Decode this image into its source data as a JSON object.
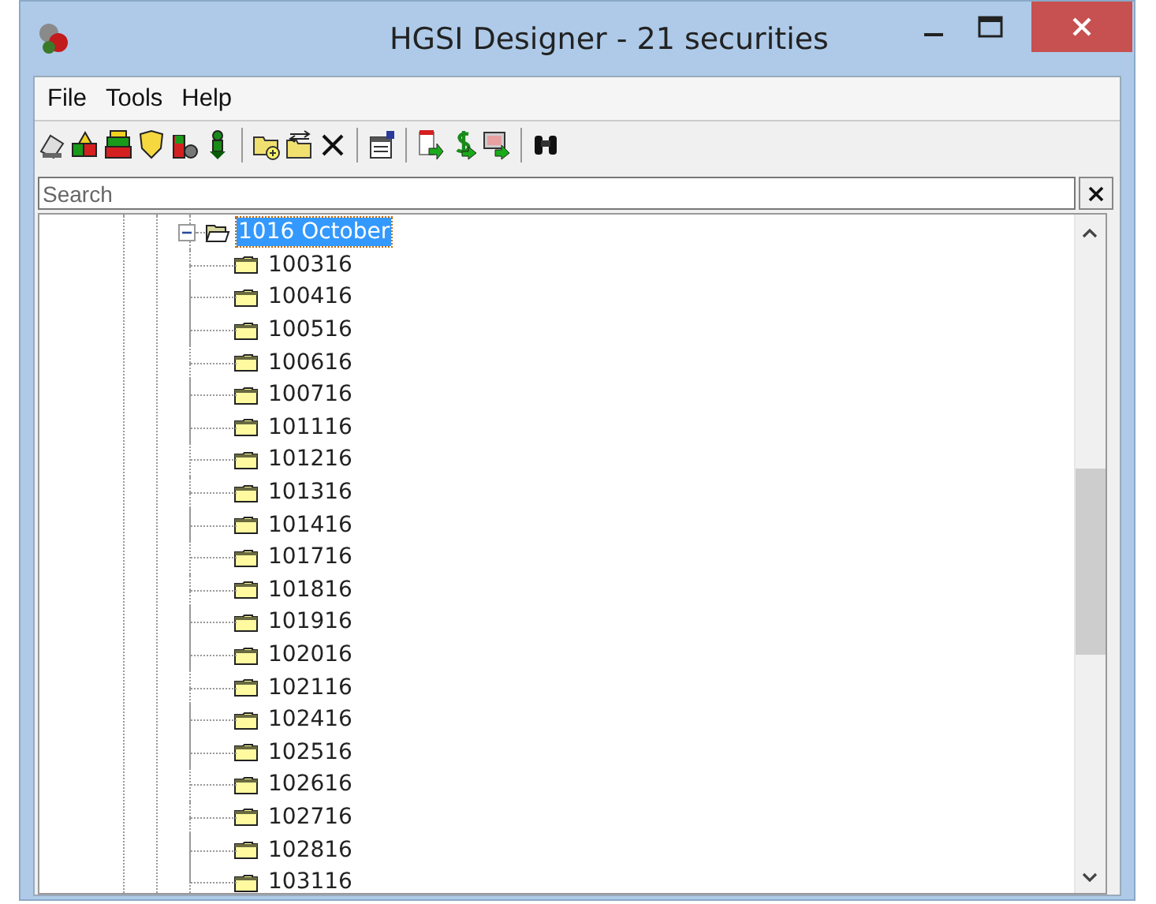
{
  "window": {
    "title": "HGSI Designer - 21 securities"
  },
  "menu": [
    "File",
    "Tools",
    "Help"
  ],
  "search": {
    "placeholder": "Search"
  },
  "tree": {
    "label": "1016 October",
    "selected": true,
    "expanded": true,
    "children": [
      {
        "label": "100316",
        "selected": false
      },
      {
        "label": "100416",
        "selected": false
      },
      {
        "label": "100516",
        "selected": false
      },
      {
        "label": "100616",
        "selected": false
      },
      {
        "label": "100716",
        "selected": false
      },
      {
        "label": "101116",
        "selected": false
      },
      {
        "label": "101216",
        "selected": false
      },
      {
        "label": "101316",
        "selected": false
      },
      {
        "label": "101416",
        "selected": false
      },
      {
        "label": "101716",
        "selected": false
      },
      {
        "label": "101816",
        "selected": false
      },
      {
        "label": "101916",
        "selected": false
      },
      {
        "label": "102016",
        "selected": false
      },
      {
        "label": "102116",
        "selected": false
      },
      {
        "label": "102416",
        "selected": false
      },
      {
        "label": "102516",
        "selected": false
      },
      {
        "label": "102616",
        "selected": false
      },
      {
        "label": "102716",
        "selected": false
      },
      {
        "label": "102816",
        "selected": false
      },
      {
        "label": "103116",
        "selected": false
      }
    ]
  }
}
